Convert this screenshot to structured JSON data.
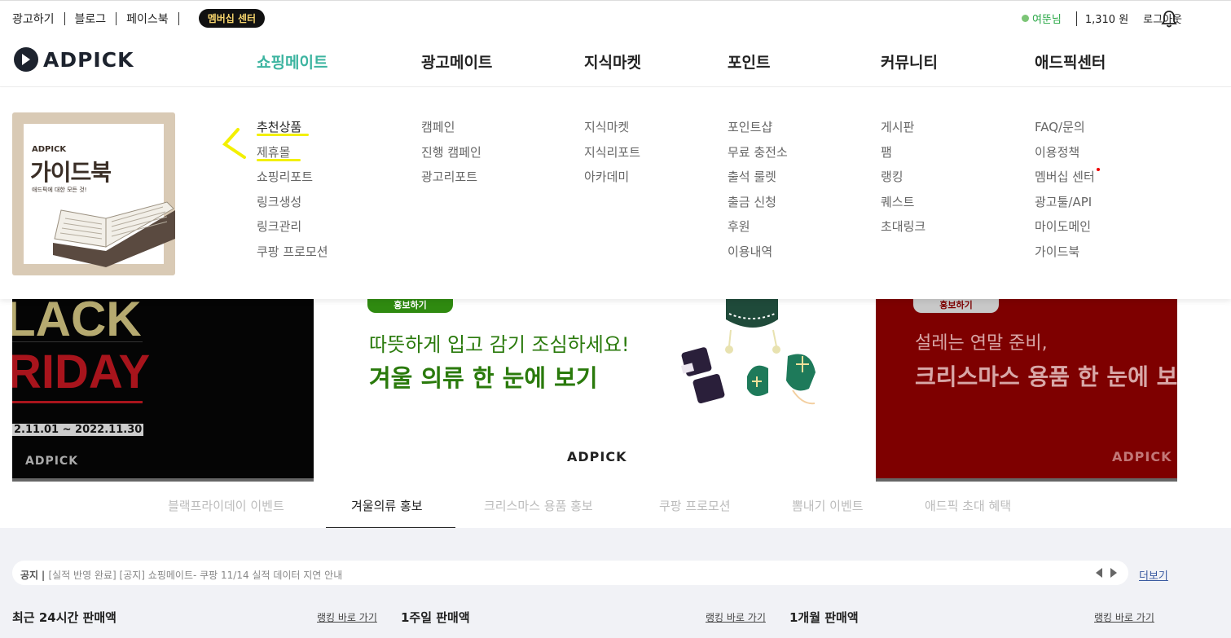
{
  "topbar": {
    "links": [
      "광고하기",
      "블로그",
      "페이스북"
    ],
    "membership": "멤버십 센터",
    "user": "여뚠님",
    "point": "1,310 원",
    "logout": "로그아웃"
  },
  "logo": "ADPICK",
  "nav": [
    "쇼핑메이트",
    "광고메이트",
    "지식마켓",
    "포인트",
    "커뮤니티",
    "애드픽센터"
  ],
  "guidebook": {
    "brand": "ADPICK",
    "title": "가이드북",
    "subtitle": "애드픽에 대한 모든 것!"
  },
  "menu": {
    "shopping": [
      "추천상품",
      "제휴몰",
      "쇼핑리포트",
      "링크생성",
      "링크관리",
      "쿠팡 프로모션"
    ],
    "ad": [
      "캠페인",
      "진행 캠페인",
      "광고리포트"
    ],
    "knowledge": [
      "지식마켓",
      "지식리포트",
      "아카데미"
    ],
    "point": [
      "포인트샵",
      "무료 충전소",
      "출석 룰렛",
      "출금 신청",
      "후원",
      "이용내역"
    ],
    "community": [
      "게시판",
      "팸",
      "랭킹",
      "퀘스트",
      "초대링크"
    ],
    "center": [
      "FAQ/문의",
      "이용정책",
      "멤버십 센터",
      "광고툴/API",
      "마이도메인",
      "가이드북"
    ]
  },
  "banners": {
    "left": {
      "line1": "LACK",
      "line2": "RIDAY",
      "date": "2.11.01 ~ 2022.11.30",
      "logo": "ADPICK"
    },
    "mid": {
      "pill": "홍보하기",
      "line1": "따뜻하게 입고 감기 조심하세요!",
      "line2": "겨울 의류 한 눈에 보기",
      "logo": "ADPICK"
    },
    "right": {
      "pill": "홍보하기",
      "line1": "설레는 연말 준비,",
      "line2": "크리스마스 용품 한 눈에 보",
      "logo": "ADPICK"
    }
  },
  "tabs": [
    "블랙프라이데이 이벤트",
    "겨울의류 홍보",
    "크리스마스 용품 홍보",
    "쿠팡 프로모션",
    "뽐내기 이벤트",
    "애드픽 초대 혜택"
  ],
  "notice": {
    "label": "공지",
    "text": "[실적 반영 완료] [공지] 쇼핑메이트- 쿠팡 11/14 실적 데이터 지연 안내",
    "more": "더보기"
  },
  "sections": [
    {
      "title": "최근 24시간 판매액",
      "link": "랭킹 바로 가기"
    },
    {
      "title": "1주일 판매액",
      "link": "랭킹 바로 가기"
    },
    {
      "title": "1개월 판매액",
      "link": "랭킹 바로 가기"
    }
  ],
  "colors": {
    "accent": "#3cb4a0",
    "winter_green": "#2a7a0c",
    "xmas_red": "#7e0000"
  }
}
